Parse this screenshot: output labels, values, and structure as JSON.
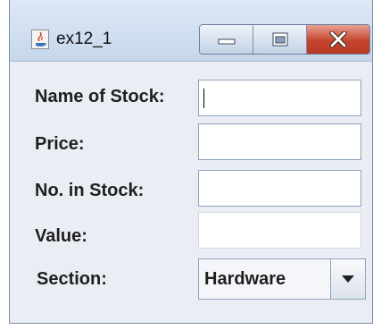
{
  "window": {
    "title": "ex12_1",
    "icon": "java-cup-icon",
    "controls": [
      "minimize-icon",
      "maximize-icon",
      "close-icon"
    ]
  },
  "form": {
    "name_label": "Name of Stock:",
    "name_value": "",
    "price_label": "Price:",
    "price_value": "",
    "stock_label": "No. in Stock:",
    "stock_value": "",
    "value_label": "Value:",
    "value_value": "",
    "section_label": "Section:",
    "section_selected": "Hardware"
  },
  "colors": {
    "client_bg": "#eaeef4",
    "close_button": "#c5452f",
    "titlebar": "#c6d7ec"
  }
}
